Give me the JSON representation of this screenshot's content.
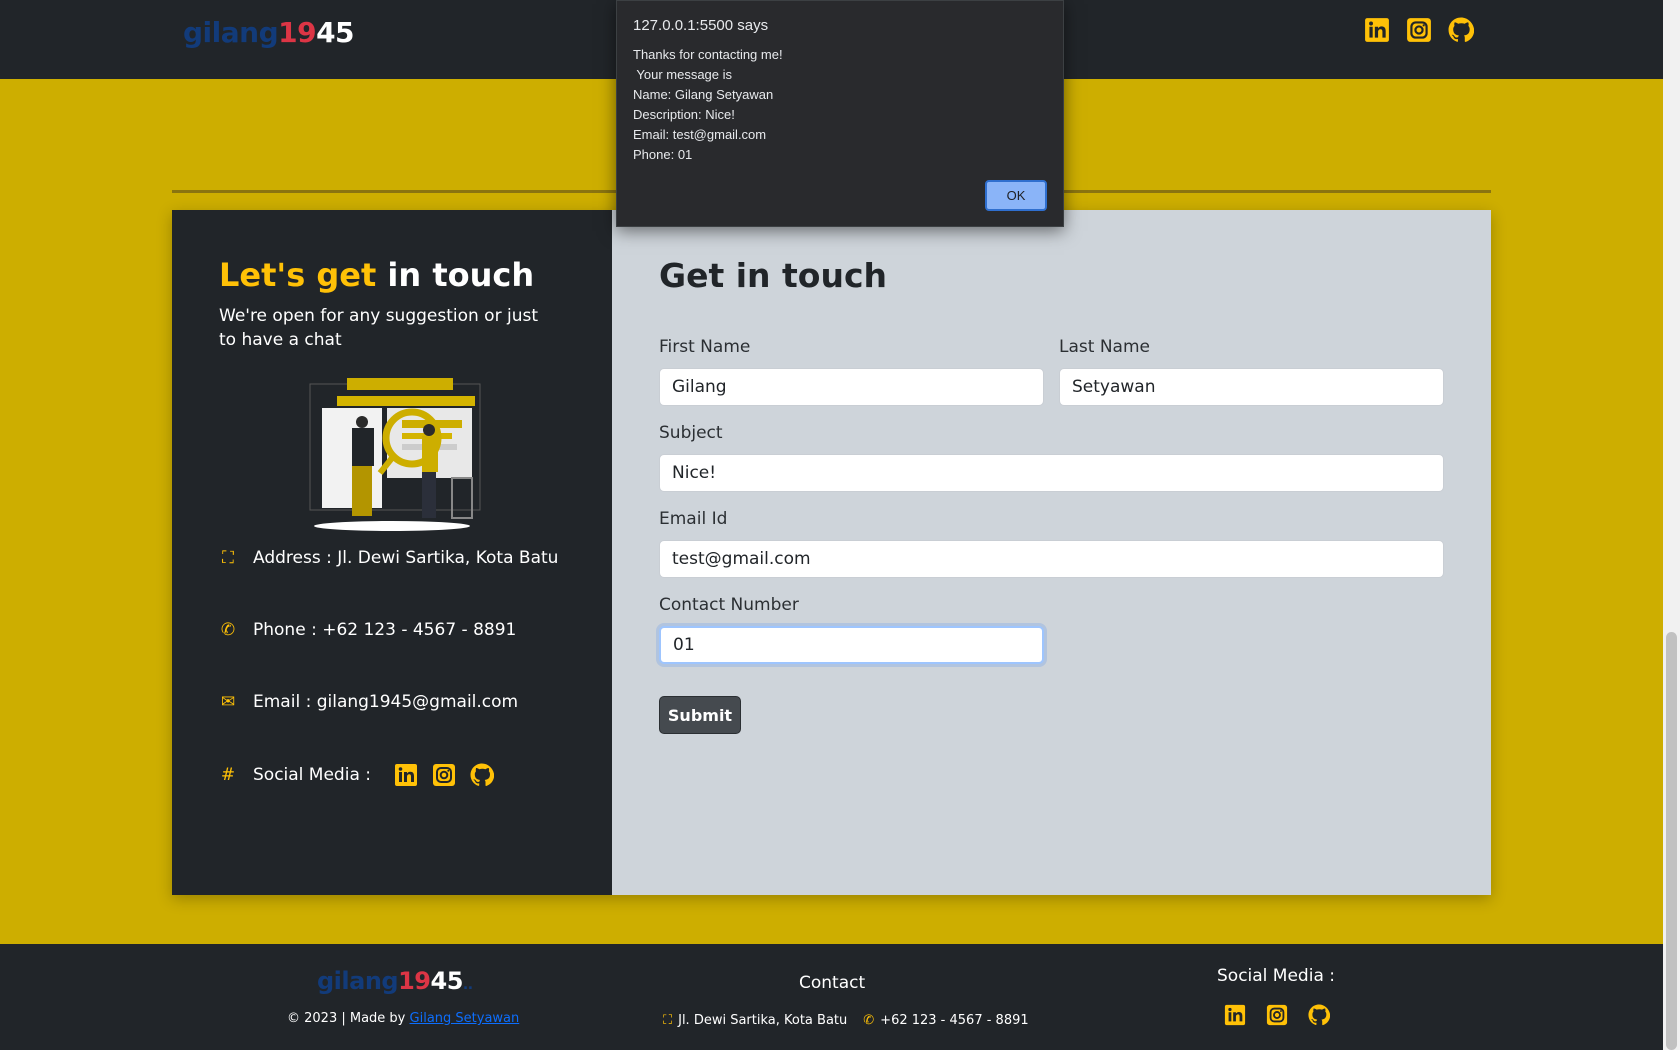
{
  "navbar": {
    "brand": {
      "part1": "gilang",
      "part2": "19",
      "part3": "45"
    },
    "social": [
      {
        "name": "linkedin-icon"
      },
      {
        "name": "instagram-icon"
      },
      {
        "name": "github-icon"
      }
    ]
  },
  "colors": {
    "accent": "#ffc107",
    "dark": "#212529",
    "page_bg": "#cdae00",
    "form_bg": "#ced4da"
  },
  "contact_info": {
    "title_accent": "Let's get",
    "title_rest": " in touch",
    "subtitle": "We're open for any suggestion or just to have a chat",
    "address": "Address : Jl. Dewi Sartika, Kota Batu",
    "phone": "Phone : +62 123 - 4567 - 8891",
    "email": "Email : gilang1945@gmail.com",
    "social_label": "Social Media :",
    "hash": "#"
  },
  "form": {
    "title": "Get in touch",
    "first_name_label": "First Name",
    "first_name_value": "Gilang",
    "last_name_label": "Last Name",
    "last_name_value": "Setyawan",
    "subject_label": "Subject",
    "subject_value": "Nice!",
    "email_label": "Email Id",
    "email_value": "test@gmail.com",
    "contact_label": "Contact Number",
    "contact_value": "01",
    "submit_label": "Submit"
  },
  "footer": {
    "brand": {
      "part1": "gilang",
      "part2": "19",
      "part3": "45",
      "part4": ".."
    },
    "copyright_prefix": "© 2023 | Made by ",
    "author": "Gilang Setyawan",
    "contact_title": "Contact",
    "address": "Jl. Dewi Sartika, Kota Batu",
    "phone": "+62 123 - 4567 - 8891",
    "social_title": "Social Media :"
  },
  "dialog": {
    "title": "127.0.0.1:5500 says",
    "lines": [
      "Thanks for contacting me!",
      " Your message is",
      "Name: Gilang Setyawan",
      "Description: Nice!",
      "Email: test@gmail.com",
      "Phone: 01"
    ],
    "ok_label": "OK"
  }
}
